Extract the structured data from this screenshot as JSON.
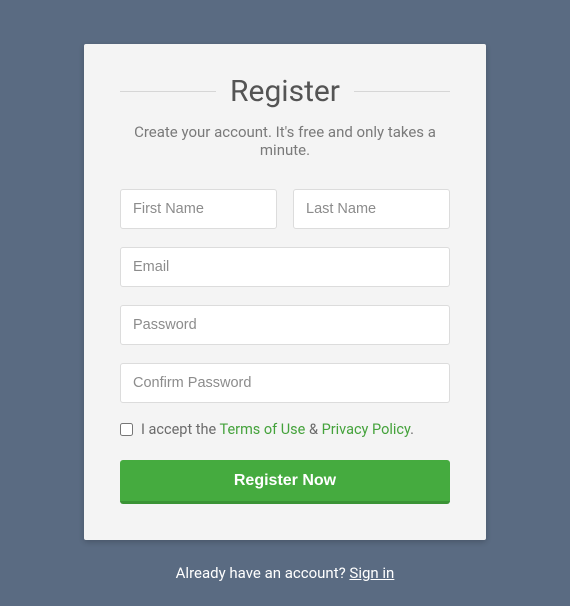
{
  "card": {
    "title": "Register",
    "subtitle": "Create your account. It's free and only takes a minute."
  },
  "form": {
    "first_name_placeholder": "First Name",
    "last_name_placeholder": "Last Name",
    "email_placeholder": "Email",
    "password_placeholder": "Password",
    "confirm_password_placeholder": "Confirm Password",
    "accept_prefix": "I accept the ",
    "terms_label": "Terms of Use",
    "accept_separator": " & ",
    "privacy_label": "Privacy Policy",
    "accept_suffix": ".",
    "submit_label": "Register Now"
  },
  "footer": {
    "prompt": "Already have an account? ",
    "signin_label": "Sign in"
  }
}
